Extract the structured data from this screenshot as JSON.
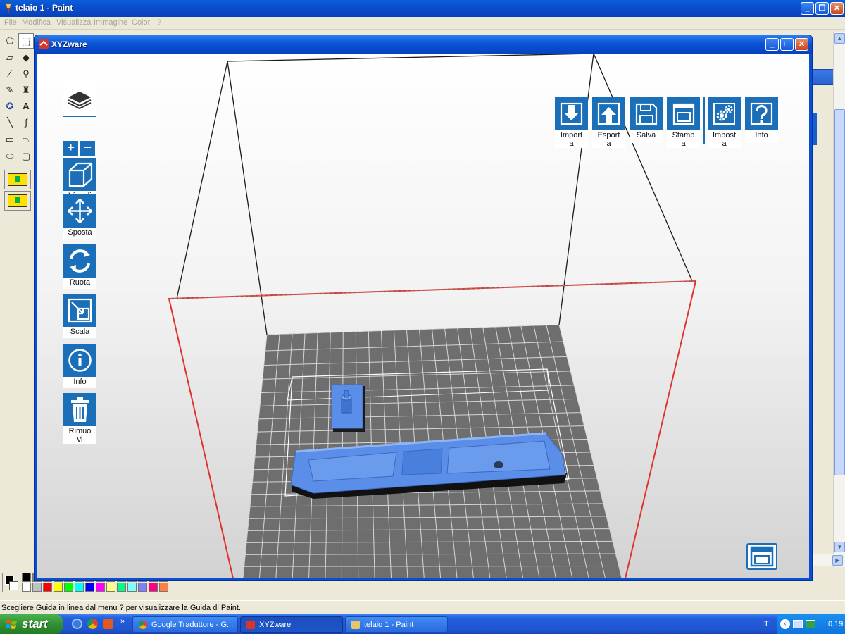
{
  "paint": {
    "title": "telaio 1 - Paint",
    "menu": [
      "File",
      "Modifica",
      "Visualizza",
      "Immagine",
      "Colori",
      "?"
    ],
    "status": "Scegliere Guida in linea dal menu ? per visualizzare la Guida di Paint.",
    "palette_colors": [
      "#ffffff",
      "#c0c0c0",
      "#ff0000",
      "#ffff00",
      "#00ff00",
      "#00ffff",
      "#0000ff",
      "#ff00ff",
      "#ffff80",
      "#00ff80",
      "#80ffff",
      "#8080ff",
      "#ff0080",
      "#ff8040"
    ],
    "palette_colors_dark": [
      "#000000",
      "#808080",
      "#800000",
      "#808000",
      "#008000",
      "#008080",
      "#000080",
      "#800080",
      "#808040",
      "#004040",
      "#0080ff",
      "#004080",
      "#8000ff",
      "#804000"
    ]
  },
  "xyzware": {
    "title": "XYZware",
    "sidebar": {
      "visualizza": [
        "Visuali",
        "z"
      ],
      "sposta": "Sposta",
      "ruota": "Ruota",
      "scala": "Scala",
      "info": "Info",
      "rimuovi": [
        "Rimuo",
        "vi"
      ]
    },
    "toolbar": {
      "importa": [
        "Import",
        "a"
      ],
      "esporta": [
        "Esport",
        "a"
      ],
      "salva": "Salva",
      "stampa": [
        "Stamp",
        "a"
      ],
      "impostazioni": [
        "Impost",
        "a"
      ],
      "info": "Info"
    },
    "colors": {
      "accent": "#1b6fb8",
      "model": "#5a8ee8",
      "bed": "#6e6e6e",
      "bed_outline": "#e0322c"
    }
  },
  "taskbar": {
    "start": "start",
    "tasks": [
      "Google Traduttore - G...",
      "XYZware",
      "telaio 1 - Paint"
    ],
    "language": "IT",
    "clock": "0.19"
  }
}
